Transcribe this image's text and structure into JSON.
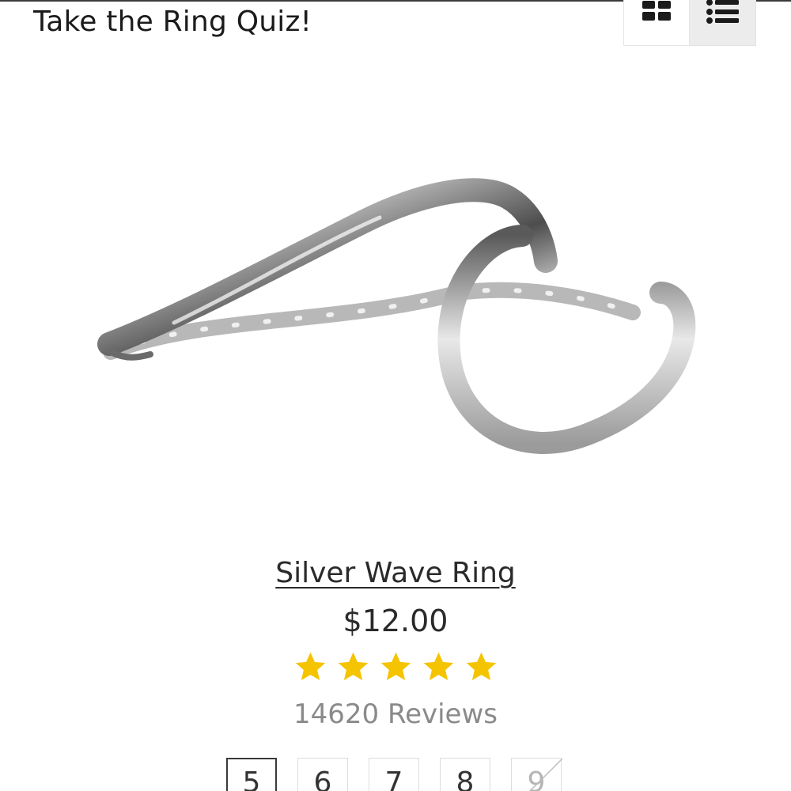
{
  "header": {
    "quiz_link": "Take the Ring Quiz!",
    "view_toggle": {
      "grid_icon": "grid-view-icon",
      "list_icon": "list-view-icon",
      "active": "list"
    }
  },
  "product": {
    "image_icon": "silver-wave-ring-image",
    "name": "Silver Wave Ring",
    "price": "$12.00",
    "rating": {
      "value": 5,
      "max": 5,
      "star_color": "#f5c400"
    },
    "reviews": "14620 Reviews",
    "sizes": [
      {
        "label": "5",
        "selected": true,
        "available": true
      },
      {
        "label": "6",
        "selected": false,
        "available": true
      },
      {
        "label": "7",
        "selected": false,
        "available": true
      },
      {
        "label": "8",
        "selected": false,
        "available": true
      },
      {
        "label": "9",
        "selected": false,
        "available": false
      }
    ]
  }
}
